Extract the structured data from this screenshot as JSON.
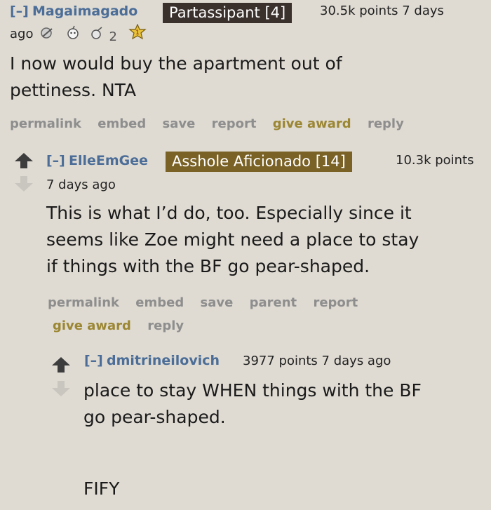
{
  "comments": [
    {
      "collapse": "[–]",
      "author": "Magaimagado",
      "flair": "Partassipant [4]",
      "points_time": "30.5k points 7 days",
      "time_cont": "ago",
      "award_count": "2",
      "body_lines": [
        "I now would buy the apartment out of",
        "pettiness. NTA"
      ],
      "actions": [
        "permalink",
        "embed",
        "save",
        "report",
        "give award",
        "reply"
      ]
    },
    {
      "collapse": "[–]",
      "author": "ElleEmGee",
      "flair": "Asshole Aficionado [14]",
      "points": "10.3k points",
      "time": "7 days ago",
      "body_lines": [
        "This is what I’d do, too. Especially since it",
        "seems like Zoe might need a place to stay",
        "if things with the BF go pear-shaped."
      ],
      "actions_row1": [
        "permalink",
        "embed",
        "save",
        "parent",
        "report"
      ],
      "actions_row2": [
        "give award",
        "reply"
      ]
    },
    {
      "collapse": "[–]",
      "author": "dmitrineilovich",
      "points_time": "3977 points 7 days ago",
      "body_lines": [
        "place to stay WHEN things with the BF",
        "go pear-shaped."
      ],
      "body_extra": "FIFY"
    }
  ],
  "colors": {
    "background": "#dfdbd3",
    "author": "#4b6d97",
    "flair_dark": "#3a302c",
    "flair_olive": "#7a6226",
    "award_action": "#9b8632",
    "action": "#8e8e8e"
  },
  "icons": [
    "award-icon-1",
    "award-icon-2",
    "award-icon-3",
    "award-icon-4",
    "upvote-icon",
    "downvote-icon"
  ]
}
